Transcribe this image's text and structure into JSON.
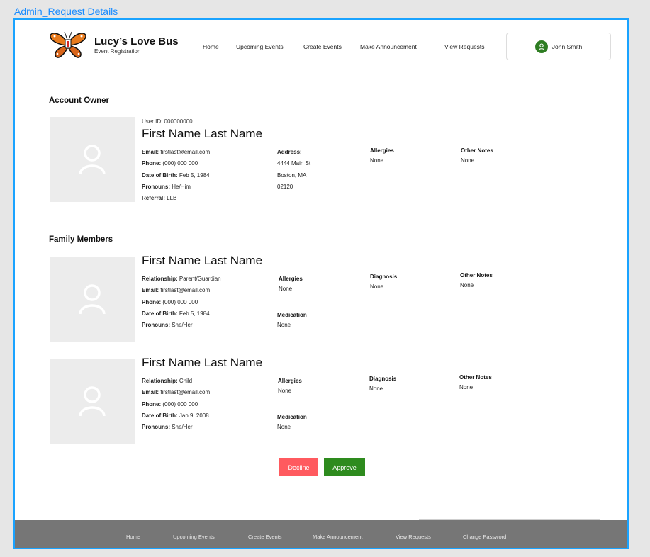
{
  "frame_label": "Admin_Request Details",
  "brand": {
    "name": "Lucy’s Love Bus",
    "subtitle": "Event Registration"
  },
  "nav": [
    "Home",
    "Upcoming Events",
    "Create Events",
    "Make Announcement",
    "View Requests"
  ],
  "user": {
    "name": "John Smith"
  },
  "account_owner": {
    "section_title": "Account Owner",
    "user_id": "User ID: 000000000",
    "name": "First Name Last Name",
    "email_label": "Email:",
    "email": " firstlast@email.com",
    "phone_label": "Phone:",
    "phone": " (000) 000 000",
    "dob_label": "Date of Birth:",
    "dob": " Feb 5, 1984",
    "pronouns_label": "Pronouns:",
    "pronouns": " He/Him",
    "referral_label": "Referral:",
    "referral": " LLB",
    "address_label": "Address:",
    "address_line1": "4444 Main St",
    "address_line2": "Boston, MA",
    "address_line3": "02120",
    "allergies_label": "Allergies",
    "allergies": "None",
    "notes_label": "Other Notes",
    "notes": "None"
  },
  "family": {
    "section_title": "Family Members",
    "members": [
      {
        "name": "First Name Last Name",
        "relationship_label": "Relationship:",
        "relationship": " Parent/Guardian",
        "email_label": "Email:",
        "email": " firstlast@email.com",
        "phone_label": "Phone:",
        "phone": " (000) 000 000",
        "dob_label": "Date of Birth:",
        "dob": " Feb 5, 1984",
        "pronouns_label": "Pronouns:",
        "pronouns": " She/Her",
        "allergies_label": "Allergies",
        "allergies": "None",
        "medication_label": "Medication",
        "medication": "None",
        "diagnosis_label": "Diagnosis",
        "diagnosis": "None",
        "notes_label": "Other Notes",
        "notes": "None"
      },
      {
        "name": "First Name Last Name",
        "relationship_label": "Relationship:",
        "relationship": " Child",
        "email_label": "Email:",
        "email": " firstlast@email.com",
        "phone_label": "Phone:",
        "phone": " (000) 000 000",
        "dob_label": "Date of Birth:",
        "dob": " Jan 9, 2008",
        "pronouns_label": "Pronouns:",
        "pronouns": " She/Her",
        "allergies_label": "Allergies",
        "allergies": "None",
        "medication_label": "Medication",
        "medication": "None",
        "diagnosis_label": "Diagnosis",
        "diagnosis": "None",
        "notes_label": "Other Notes",
        "notes": "None"
      }
    ]
  },
  "actions": {
    "decline": "Decline",
    "approve": "Approve"
  },
  "footer": [
    "Home",
    "Upcoming Events",
    "Create Events",
    "Make Announcement",
    "View Requests",
    "Change Password"
  ],
  "colors": {
    "accent": "#1aa3ff",
    "decline": "#ff5a5f",
    "approve": "#2e8b1e",
    "footer": "#767676",
    "avatar": "#2e7d22"
  },
  "icons": {
    "logo": "butterfly-logo-icon",
    "avatar": "user-avatar-icon",
    "photo": "person-placeholder-icon"
  }
}
